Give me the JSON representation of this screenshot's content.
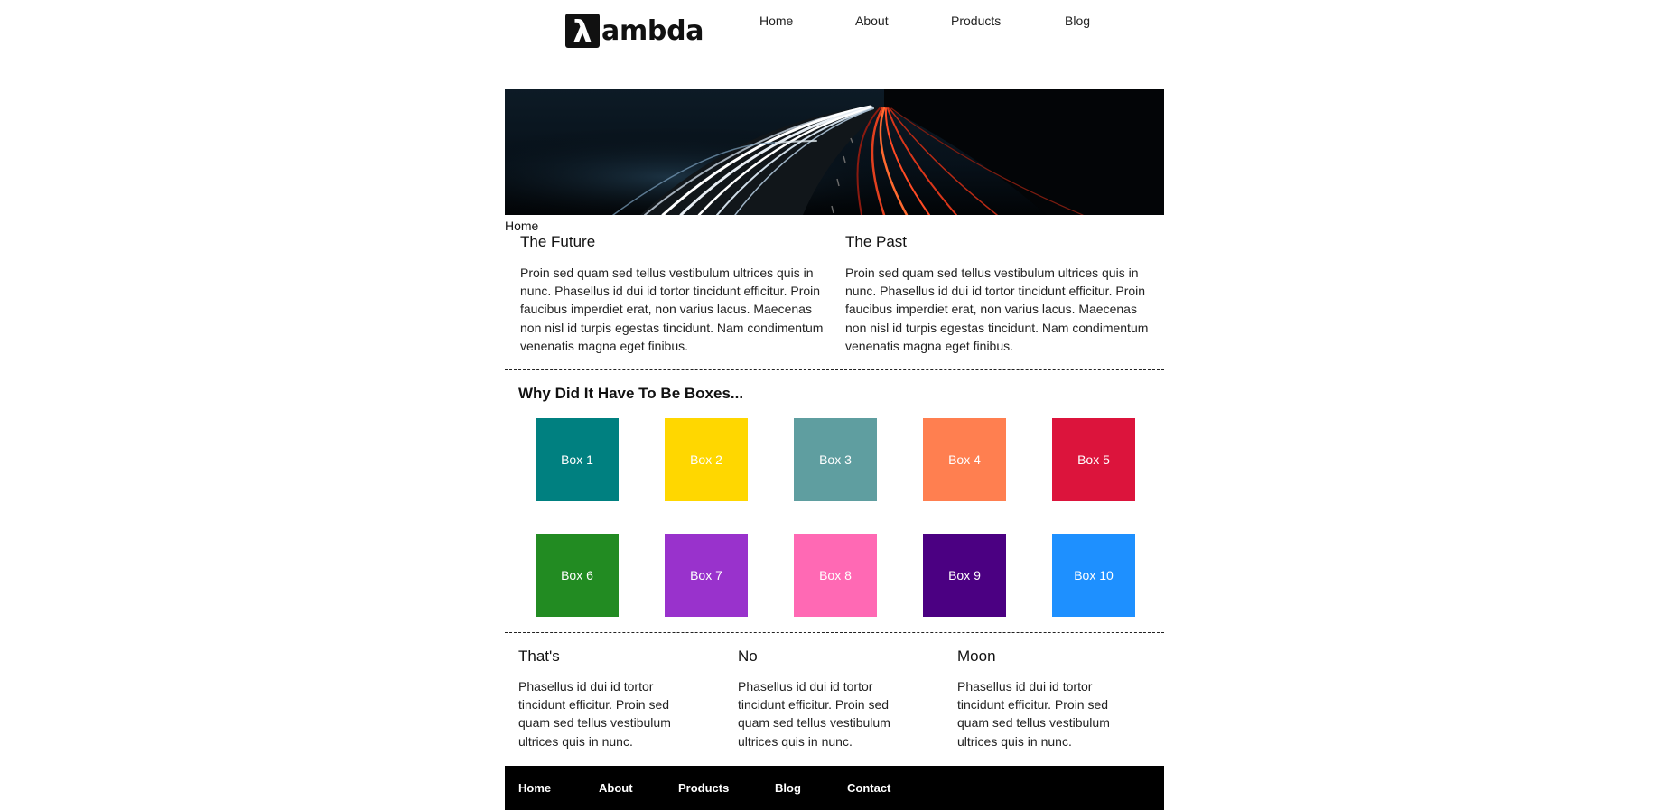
{
  "header": {
    "logo_mark": "λ",
    "logo_text": "ambda",
    "nav": [
      "Home",
      "About",
      "Products",
      "Blog"
    ]
  },
  "breadcrumb": "Home",
  "intro": [
    {
      "title": "The Future",
      "text": "Proin sed quam sed tellus vestibulum ultrices quis in nunc. Phasellus id dui id tortor tincidunt efficitur. Proin faucibus imperdiet erat, non varius lacus. Maecenas non nisl id turpis egestas tincidunt. Nam condimentum venenatis magna eget finibus."
    },
    {
      "title": "The Past",
      "text": "Proin sed quam sed tellus vestibulum ultrices quis in nunc. Phasellus id dui id tortor tincidunt efficitur. Proin faucibus imperdiet erat, non varius lacus. Maecenas non nisl id turpis egestas tincidunt. Nam condimentum venenatis magna eget finibus."
    }
  ],
  "boxes_section": {
    "title": "Why Did It Have To Be Boxes...",
    "boxes": [
      {
        "label": "Box 1",
        "color": "#008080"
      },
      {
        "label": "Box 2",
        "color": "#FFD700"
      },
      {
        "label": "Box 3",
        "color": "#5F9EA0"
      },
      {
        "label": "Box 4",
        "color": "#FF7F50"
      },
      {
        "label": "Box 5",
        "color": "#DC143C"
      },
      {
        "label": "Box 6",
        "color": "#228B22"
      },
      {
        "label": "Box 7",
        "color": "#9932CC"
      },
      {
        "label": "Box 8",
        "color": "#FF69B4"
      },
      {
        "label": "Box 9",
        "color": "#4B0082"
      },
      {
        "label": "Box 10",
        "color": "#1E90FF"
      }
    ]
  },
  "features": [
    {
      "title": "That's",
      "text": "Phasellus id dui id tortor tincidunt efficitur. Proin sed quam sed tellus vestibulum ultrices quis in nunc."
    },
    {
      "title": "No",
      "text": "Phasellus id dui id tortor tincidunt efficitur. Proin sed quam sed tellus vestibulum ultrices quis in nunc."
    },
    {
      "title": "Moon",
      "text": "Phasellus id dui id tortor tincidunt efficitur. Proin sed quam sed tellus vestibulum ultrices quis in nunc."
    }
  ],
  "footer": {
    "nav": [
      "Home",
      "About",
      "Products",
      "Blog",
      "Contact"
    ]
  }
}
